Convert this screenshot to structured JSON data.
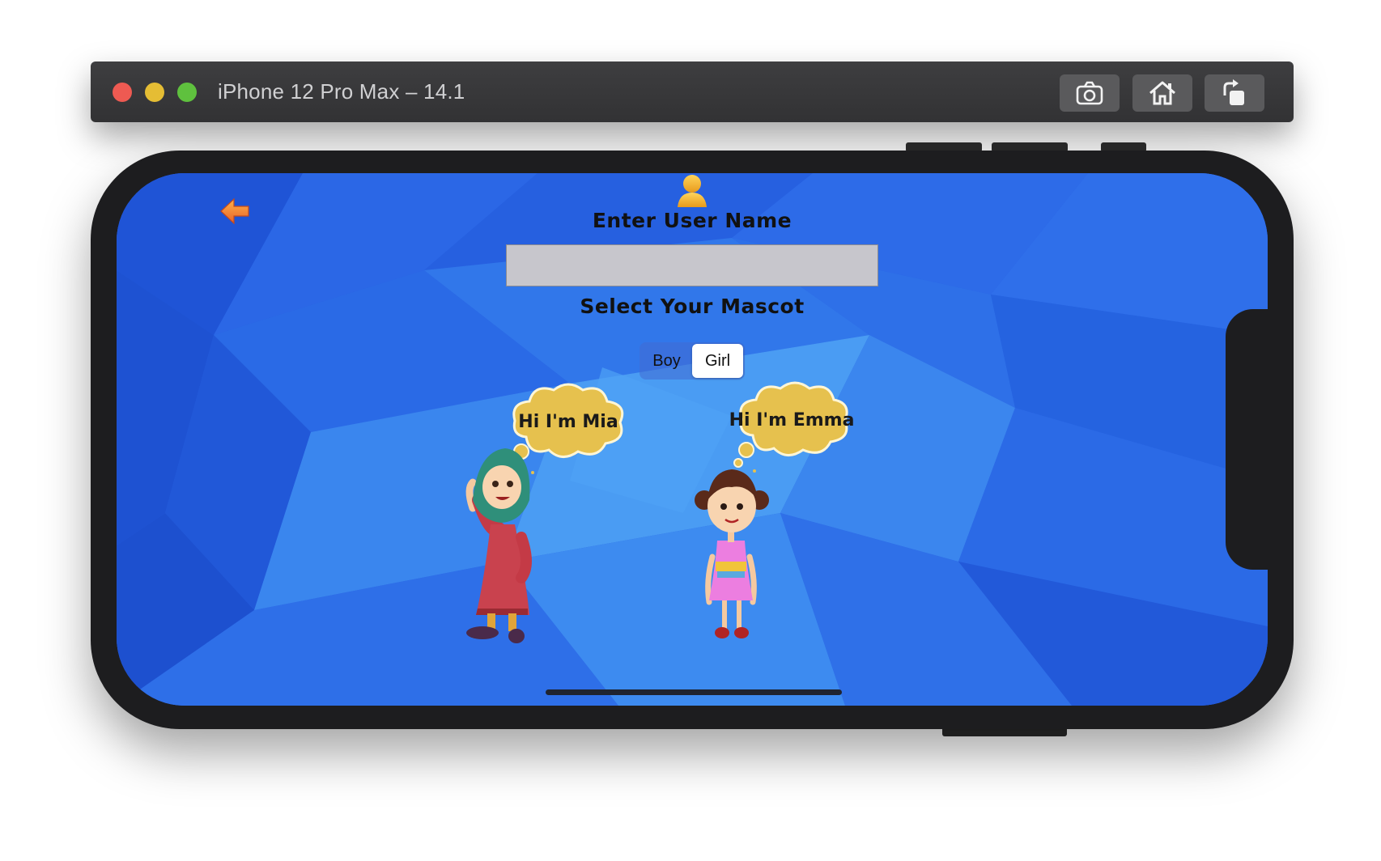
{
  "simulator": {
    "title": "iPhone 12 Pro Max – 14.1",
    "buttons": [
      "camera-icon",
      "home-icon",
      "rotate-icon"
    ]
  },
  "app": {
    "back_icon": "back-arrow-icon",
    "user_icon": "user-icon",
    "username_heading": "Enter User Name",
    "username_value": "",
    "mascot_heading": "Select Your Mascot",
    "segments": [
      {
        "label": "Boy",
        "selected": false
      },
      {
        "label": "Girl",
        "selected": true
      }
    ],
    "mascots": [
      {
        "greeting": "Hi I'm Mia"
      },
      {
        "greeting": "Hi I'm Emma"
      }
    ]
  },
  "colors": {
    "background_blue": "#2a62e2",
    "accent_orange": "#f08a24",
    "bubble_yellow": "#e6c14e"
  }
}
